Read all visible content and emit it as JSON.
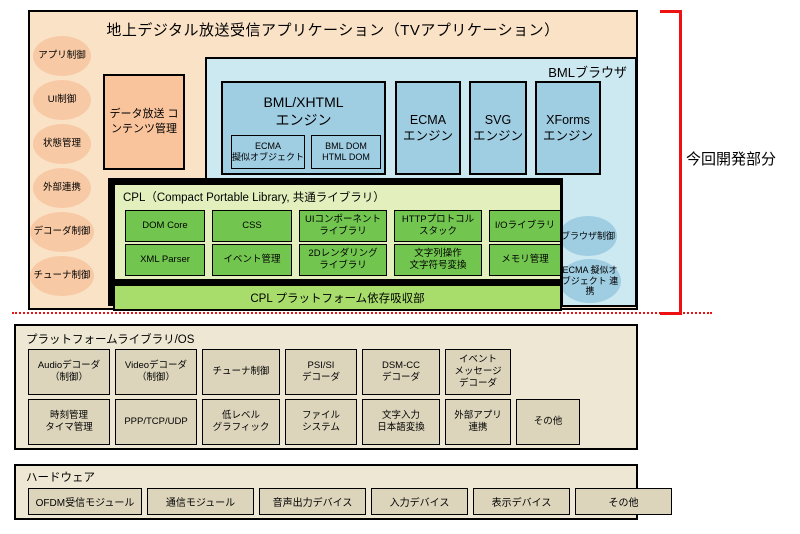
{
  "diagram": {
    "app_layer": {
      "title": "地上デジタル放送受信アプリケーション（TVアプリケーション）",
      "left_ellipses": [
        {
          "label": "アプリ制御"
        },
        {
          "label": "UI制御"
        },
        {
          "label": "状態管理"
        },
        {
          "label": "外部連携"
        },
        {
          "label": "デコーダ制御"
        },
        {
          "label": "チューナ制御"
        }
      ],
      "data_broadcast": "データ放送\nコンテンツ管理"
    },
    "bml_browser": {
      "label": "BMLブラウザ",
      "engines": [
        {
          "name": "BML/XHTML\nエンジン",
          "subs": [
            {
              "label": "ECMA\n擬似オブジェクト"
            },
            {
              "label": "BML DOM\nHTML DOM"
            }
          ]
        },
        {
          "name": "ECMA\nエンジン",
          "subs": []
        },
        {
          "name": "SVG\nエンジン",
          "subs": []
        },
        {
          "name": "XForms\nエンジン",
          "subs": []
        }
      ],
      "ellipses": [
        {
          "label": "ブラウザ制御"
        },
        {
          "label": "ECMA\n擬似オブジェクト\n連携"
        }
      ]
    },
    "cpl": {
      "title": "CPL（Compact Portable Library, 共通ライブラリ）",
      "row1": [
        {
          "label": "DOM Core"
        },
        {
          "label": "CSS"
        },
        {
          "label": "UIコンポーネント\nライブラリ"
        },
        {
          "label": "HTTPプロトコル\nスタック"
        },
        {
          "label": "I/Oライブラリ"
        }
      ],
      "row2": [
        {
          "label": "XML Parser"
        },
        {
          "label": "イベント管理"
        },
        {
          "label": "2Dレンダリング\nライブラリ"
        },
        {
          "label": "文字列操作\n文字符号変換"
        },
        {
          "label": "メモリ管理"
        }
      ],
      "bottom_bar": "CPL プラットフォーム依存吸収部"
    },
    "bracket": {
      "label": "今回開発部分",
      "color": "#EE1111"
    },
    "platform": {
      "title": "プラットフォームライブラリ/OS",
      "row1": [
        {
          "label": "Audioデコーダ\n（制御）"
        },
        {
          "label": "Videoデコーダ\n（制御）"
        },
        {
          "label": "チューナ制御"
        },
        {
          "label": "PSI/SI\nデコーダ"
        },
        {
          "label": "DSM-CC\nデコーダ"
        },
        {
          "label": "イベント\nメッセージ\nデコーダ"
        }
      ],
      "row2": [
        {
          "label": "時刻管理\nタイマ管理"
        },
        {
          "label": "PPP/TCP/UDP"
        },
        {
          "label": "低レベル\nグラフィック"
        },
        {
          "label": "ファイル\nシステム"
        },
        {
          "label": "文字入力\n日本語変換"
        },
        {
          "label": "外部アプリ\n連携"
        },
        {
          "label": "その他"
        }
      ]
    },
    "hardware": {
      "title": "ハードウェア",
      "boxes": [
        {
          "label": "OFDM受信モジュール"
        },
        {
          "label": "通信モジュール"
        },
        {
          "label": "音声出力デバイス"
        },
        {
          "label": "入力デバイス"
        },
        {
          "label": "表示デバイス"
        },
        {
          "label": "その他"
        }
      ]
    },
    "colors": {
      "app_bg": "#FAE2C6",
      "peach": "#F9C49C",
      "browser_bg": "#CCE8F0",
      "engine_blue": "#9FCDE2",
      "cpl_bg": "#E3F0BE",
      "cpl_green": "#72C64F",
      "cpl_bar": "#A8DD6B",
      "platform_bg": "#EDE7D3",
      "platform_box": "#DCD5BC",
      "bracket_red": "#EE1111"
    }
  }
}
